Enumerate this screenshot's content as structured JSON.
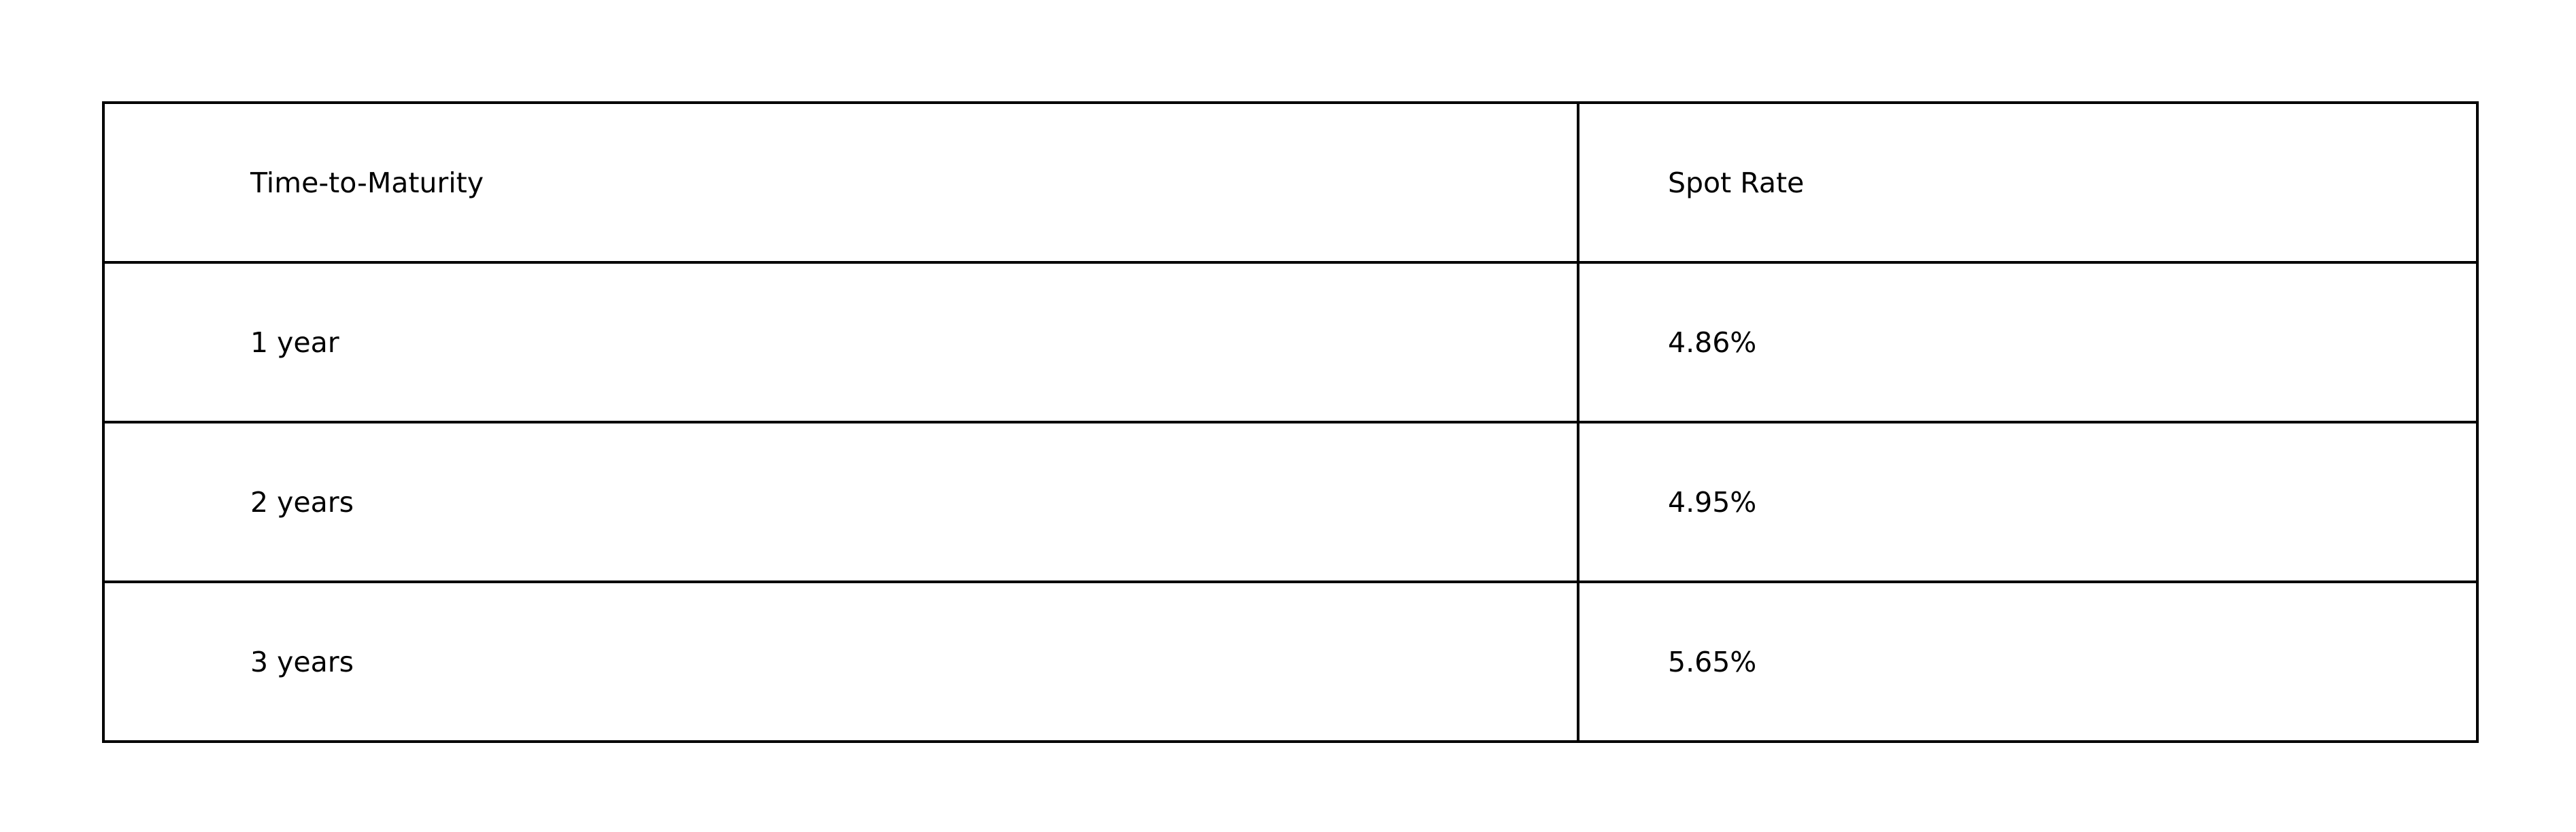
{
  "table": {
    "columns": [
      "Time-to-Maturity",
      "Spot Rate"
    ],
    "rows": [
      {
        "maturity": "1 year",
        "spot_rate": "4.86%"
      },
      {
        "maturity": "2 years",
        "spot_rate": "4.95%"
      },
      {
        "maturity": "3 years",
        "spot_rate": "5.65%"
      }
    ]
  }
}
